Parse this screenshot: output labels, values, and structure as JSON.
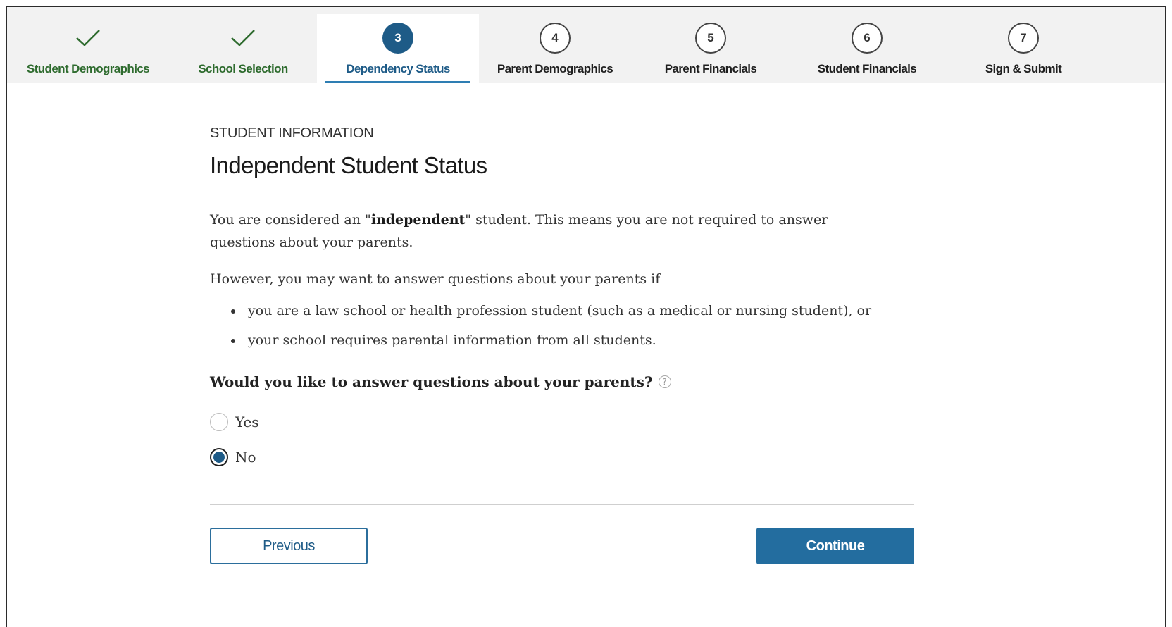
{
  "steps": [
    {
      "label": "Student Demographics",
      "state": "done",
      "icon": "check-icon"
    },
    {
      "label": "School Selection",
      "state": "done",
      "icon": "check-icon"
    },
    {
      "label": "Dependency Status",
      "state": "current",
      "number": "3"
    },
    {
      "label": "Parent Demographics",
      "state": "todo",
      "number": "4"
    },
    {
      "label": "Parent Financials",
      "state": "todo",
      "number": "5"
    },
    {
      "label": "Student Financials",
      "state": "todo",
      "number": "6"
    },
    {
      "label": "Sign & Submit",
      "state": "todo",
      "number": "7"
    }
  ],
  "section_label": "STUDENT INFORMATION",
  "title": "Independent Student Status",
  "para1": {
    "before": "You are considered an \"",
    "bold": "independent",
    "after": "\" student. This means you are not required to answer questions about your parents."
  },
  "para2": "However, you may want to answer questions about your parents if",
  "bullets": [
    "you are a law school or health profession student (such as a medical or nursing student), or",
    "your school requires parental information from all students."
  ],
  "question": "Would you like to answer questions about your parents?",
  "help_icon": "question-mark-icon",
  "options": {
    "yes": "Yes",
    "no": "No",
    "selected": "No"
  },
  "buttons": {
    "previous": "Previous",
    "continue": "Continue"
  },
  "colors": {
    "accent": "#1e5b87",
    "done_green": "#2e6b2e",
    "button_blue": "#236d9f"
  }
}
